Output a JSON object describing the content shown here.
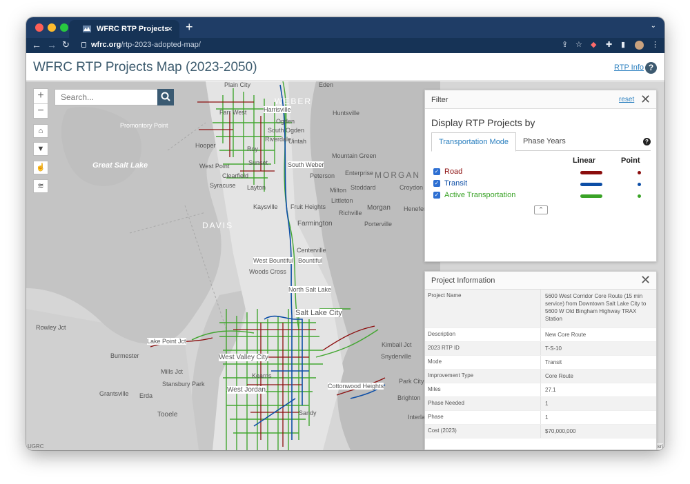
{
  "browser": {
    "tab_title": "WFRC RTP Projects",
    "tab_close": "×",
    "new_tab": "+",
    "url_host": "wfrc.org",
    "url_path": "/rtp-2023-adopted-map/"
  },
  "app": {
    "title": "WFRC RTP Projects Map (2023-2050)",
    "rtp_info": "RTP Info",
    "help": "?"
  },
  "map": {
    "search_placeholder": "Search...",
    "attribution_left": "UGRC",
    "attribution_right": "Powered by Esri",
    "labels": {
      "weber": "WEBER",
      "davis": "DAVIS",
      "morgan": "MORGAN",
      "lake": "Great Salt Lake",
      "promontory": "Promontory Point",
      "eden": "Eden",
      "huntsville": "Huntsville",
      "ogden": "Ogden",
      "south_ogden": "South Ogden",
      "hooper": "Hooper",
      "roy": "Roy",
      "west_point": "West Point",
      "clearfield": "Clearfield",
      "syracuse": "Syracuse",
      "layton": "Layton",
      "kaysville": "Kaysville",
      "fruit_heights": "Fruit Heights",
      "farmington": "Farmington",
      "centerville": "Centerville",
      "west_bountiful": "West Bountiful",
      "bountiful": "Bountiful",
      "woods_cross": "Woods Cross",
      "north_salt_lake": "North Salt Lake",
      "salt_lake_city": "Salt Lake City",
      "morgan_city": "Morgan",
      "mountain_green": "Mountain Green",
      "peterson": "Peterson",
      "milton": "Milton",
      "stoddard": "Stoddard",
      "littleton": "Littleton",
      "richville": "Richville",
      "porterville": "Porterville",
      "croydon": "Croydon",
      "enterprise": "Enterprise",
      "henefer": "Henefer",
      "uintah": "Uintah",
      "south_weber": "South Weber",
      "rowley": "Rowley Jct",
      "burmester": "Burmester",
      "lake_point": "Lake Point Jct",
      "mills_jct": "Mills Jct",
      "stansbury_park": "Stansbury Park",
      "grantsville": "Grantsville",
      "erda": "Erda",
      "tooele": "Tooele",
      "west_valley": "West Valley City",
      "west_jordan": "West Jordan",
      "kearns": "Kearns",
      "sandy": "Sandy",
      "kimball": "Kimball Jct",
      "snyderville": "Snyderville",
      "park_city": "Park City",
      "brighton": "Brighton",
      "interlaken": "Interlaken",
      "cottonwood": "Cottonwood Heights",
      "plain_city": "Plain City",
      "harrisville": "Harrisville",
      "farr_west": "Farr West",
      "riverdale": "Riverdale",
      "sunset": "Sunset"
    }
  },
  "filter": {
    "title": "Filter",
    "reset": "reset",
    "heading": "Display RTP Projects by",
    "tabs": [
      "Transportation Mode",
      "Phase Years"
    ],
    "col_linear": "Linear",
    "col_point": "Point",
    "modes": [
      {
        "label": "Road",
        "color": "#8b0d0d"
      },
      {
        "label": "Transit",
        "color": "#0d4ea6"
      },
      {
        "label": "Active Transportation",
        "color": "#3aa327"
      }
    ]
  },
  "project_info": {
    "title": "Project Information",
    "rows": [
      {
        "key": "Project Name",
        "value": "5600 West Corridor Core Route (15 min service) from Downtown Salt Lake City to 5600 W Old Bingham Highway TRAX Station"
      },
      {
        "key": "Description",
        "value": "New Core Route"
      },
      {
        "key": "2023 RTP ID",
        "value": "T-S-10"
      },
      {
        "key": "Mode",
        "value": "Transit"
      },
      {
        "key": "Improvement Type",
        "value": "Core Route"
      },
      {
        "key": "Miles",
        "value": "27.1"
      },
      {
        "key": "Phase Needed",
        "value": "1"
      },
      {
        "key": "Phase",
        "value": "1"
      },
      {
        "key": "Cost (2023)",
        "value": "$70,000,000"
      }
    ]
  }
}
